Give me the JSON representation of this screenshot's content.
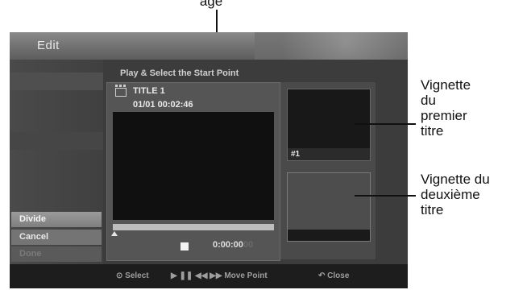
{
  "callouts": {
    "top": "age",
    "first_thumb": [
      "Vignette",
      "du",
      "premier",
      "titre"
    ],
    "second_thumb": [
      "Vignette du",
      "deuxième",
      "titre"
    ]
  },
  "window": {
    "title": "Edit"
  },
  "menu": {
    "items": [
      {
        "label": "Divide",
        "state": "highlighted"
      },
      {
        "label": "Cancel",
        "state": "normal"
      },
      {
        "label": "Done",
        "state": "disabled"
      }
    ]
  },
  "main": {
    "heading": "Play & Select the Start Point",
    "title_name": "TITLE 1",
    "title_info": "01/01  00:02:46",
    "progress_fraction": 0.0,
    "timecode": "0:00:00",
    "timecode_frames": "00"
  },
  "thumbnails": [
    {
      "label": "#1"
    },
    {
      "label": ""
    }
  ],
  "help_bar": {
    "select": "Select",
    "move": "Move Point",
    "close": "Close"
  },
  "colors": {
    "osd_background": "#3c3c3c",
    "highlight_item": "#8d8d8d",
    "help_text": "#9e9e9e"
  }
}
